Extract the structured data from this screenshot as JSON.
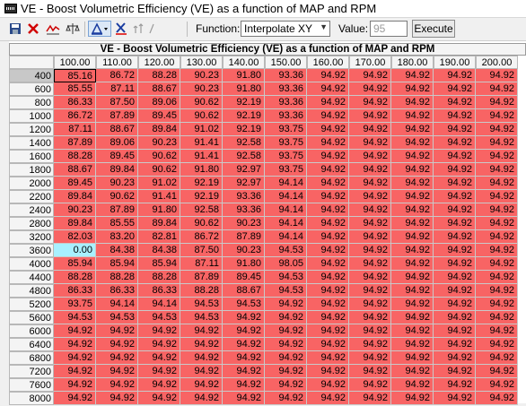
{
  "window": {
    "title": "VE - Boost Volumetric Efficiency (VE) as a function of MAP and RPM"
  },
  "toolbar": {
    "buttons": [
      {
        "name": "save-icon",
        "glyph": "▦"
      },
      {
        "name": "close-x-icon",
        "glyph": "✕"
      },
      {
        "name": "line-graph-icon",
        "glyph": "〰"
      },
      {
        "name": "balance-scale-icon",
        "glyph": "⚖"
      },
      {
        "name": "adjust-icon",
        "glyph": "▲"
      },
      {
        "name": "x-scale-icon",
        "glyph": "X"
      },
      {
        "name": "interpolate-icon",
        "glyph": "↑"
      }
    ],
    "function_label": "Function:",
    "function_value": "Interpolate XY",
    "value_label": "Value:",
    "value_value": "95",
    "execute_label": "Execute"
  },
  "table": {
    "title": "VE - Boost Volumetric Efficiency (VE) as a function of MAP and RPM",
    "columns": [
      "100.00",
      "110.00",
      "120.00",
      "130.00",
      "140.00",
      "150.00",
      "160.00",
      "170.00",
      "180.00",
      "190.00",
      "200.00"
    ],
    "rows": [
      {
        "rpm": "400",
        "values": [
          "85.16",
          "86.72",
          "88.28",
          "90.23",
          "91.80",
          "93.36",
          "94.92",
          "94.92",
          "94.92",
          "94.92",
          "94.92"
        ]
      },
      {
        "rpm": "600",
        "values": [
          "85.55",
          "87.11",
          "88.67",
          "90.23",
          "91.80",
          "93.36",
          "94.92",
          "94.92",
          "94.92",
          "94.92",
          "94.92"
        ]
      },
      {
        "rpm": "800",
        "values": [
          "86.33",
          "87.50",
          "89.06",
          "90.62",
          "92.19",
          "93.36",
          "94.92",
          "94.92",
          "94.92",
          "94.92",
          "94.92"
        ]
      },
      {
        "rpm": "1000",
        "values": [
          "86.72",
          "87.89",
          "89.45",
          "90.62",
          "92.19",
          "93.36",
          "94.92",
          "94.92",
          "94.92",
          "94.92",
          "94.92"
        ]
      },
      {
        "rpm": "1200",
        "values": [
          "87.11",
          "88.67",
          "89.84",
          "91.02",
          "92.19",
          "93.75",
          "94.92",
          "94.92",
          "94.92",
          "94.92",
          "94.92"
        ]
      },
      {
        "rpm": "1400",
        "values": [
          "87.89",
          "89.06",
          "90.23",
          "91.41",
          "92.58",
          "93.75",
          "94.92",
          "94.92",
          "94.92",
          "94.92",
          "94.92"
        ]
      },
      {
        "rpm": "1600",
        "values": [
          "88.28",
          "89.45",
          "90.62",
          "91.41",
          "92.58",
          "93.75",
          "94.92",
          "94.92",
          "94.92",
          "94.92",
          "94.92"
        ]
      },
      {
        "rpm": "1800",
        "values": [
          "88.67",
          "89.84",
          "90.62",
          "91.80",
          "92.97",
          "93.75",
          "94.92",
          "94.92",
          "94.92",
          "94.92",
          "94.92"
        ]
      },
      {
        "rpm": "2000",
        "values": [
          "89.45",
          "90.23",
          "91.02",
          "92.19",
          "92.97",
          "94.14",
          "94.92",
          "94.92",
          "94.92",
          "94.92",
          "94.92"
        ]
      },
      {
        "rpm": "2200",
        "values": [
          "89.84",
          "90.62",
          "91.41",
          "92.19",
          "93.36",
          "94.14",
          "94.92",
          "94.92",
          "94.92",
          "94.92",
          "94.92"
        ]
      },
      {
        "rpm": "2400",
        "values": [
          "90.23",
          "87.89",
          "91.80",
          "92.58",
          "93.36",
          "94.14",
          "94.92",
          "94.92",
          "94.92",
          "94.92",
          "94.92"
        ]
      },
      {
        "rpm": "2800",
        "values": [
          "89.84",
          "85.55",
          "89.84",
          "90.62",
          "90.23",
          "94.14",
          "94.92",
          "94.92",
          "94.92",
          "94.92",
          "94.92"
        ]
      },
      {
        "rpm": "3200",
        "values": [
          "82.03",
          "83.20",
          "82.81",
          "86.72",
          "87.89",
          "94.14",
          "94.92",
          "94.92",
          "94.92",
          "94.92",
          "94.92"
        ]
      },
      {
        "rpm": "3600",
        "values": [
          "0.00",
          "84.38",
          "84.38",
          "87.50",
          "90.23",
          "94.53",
          "94.92",
          "94.92",
          "94.92",
          "94.92",
          "94.92"
        ]
      },
      {
        "rpm": "4000",
        "values": [
          "85.94",
          "85.94",
          "85.94",
          "87.11",
          "91.80",
          "98.05",
          "94.92",
          "94.92",
          "94.92",
          "94.92",
          "94.92"
        ]
      },
      {
        "rpm": "4400",
        "values": [
          "88.28",
          "88.28",
          "88.28",
          "87.89",
          "89.45",
          "94.53",
          "94.92",
          "94.92",
          "94.92",
          "94.92",
          "94.92"
        ]
      },
      {
        "rpm": "4800",
        "values": [
          "86.33",
          "86.33",
          "86.33",
          "88.28",
          "88.67",
          "94.53",
          "94.92",
          "94.92",
          "94.92",
          "94.92",
          "94.92"
        ]
      },
      {
        "rpm": "5200",
        "values": [
          "93.75",
          "94.14",
          "94.14",
          "94.53",
          "94.53",
          "94.92",
          "94.92",
          "94.92",
          "94.92",
          "94.92",
          "94.92"
        ]
      },
      {
        "rpm": "5600",
        "values": [
          "94.53",
          "94.53",
          "94.53",
          "94.53",
          "94.92",
          "94.92",
          "94.92",
          "94.92",
          "94.92",
          "94.92",
          "94.92"
        ]
      },
      {
        "rpm": "6000",
        "values": [
          "94.92",
          "94.92",
          "94.92",
          "94.92",
          "94.92",
          "94.92",
          "94.92",
          "94.92",
          "94.92",
          "94.92",
          "94.92"
        ]
      },
      {
        "rpm": "6400",
        "values": [
          "94.92",
          "94.92",
          "94.92",
          "94.92",
          "94.92",
          "94.92",
          "94.92",
          "94.92",
          "94.92",
          "94.92",
          "94.92"
        ]
      },
      {
        "rpm": "6800",
        "values": [
          "94.92",
          "94.92",
          "94.92",
          "94.92",
          "94.92",
          "94.92",
          "94.92",
          "94.92",
          "94.92",
          "94.92",
          "94.92"
        ]
      },
      {
        "rpm": "7200",
        "values": [
          "94.92",
          "94.92",
          "94.92",
          "94.92",
          "94.92",
          "94.92",
          "94.92",
          "94.92",
          "94.92",
          "94.92",
          "94.92"
        ]
      },
      {
        "rpm": "7600",
        "values": [
          "94.92",
          "94.92",
          "94.92",
          "94.92",
          "94.92",
          "94.92",
          "94.92",
          "94.92",
          "94.92",
          "94.92",
          "94.92"
        ]
      },
      {
        "rpm": "8000",
        "values": [
          "94.92",
          "94.92",
          "94.92",
          "94.92",
          "94.92",
          "94.92",
          "94.92",
          "94.92",
          "94.92",
          "94.92",
          "94.92"
        ]
      }
    ],
    "selected_cell": {
      "row": 0,
      "col": 0
    },
    "highlight_cell": {
      "row": 13,
      "col": 0
    },
    "colors": {
      "cell": "#f86464",
      "highlight": "#a8f0ff"
    }
  }
}
